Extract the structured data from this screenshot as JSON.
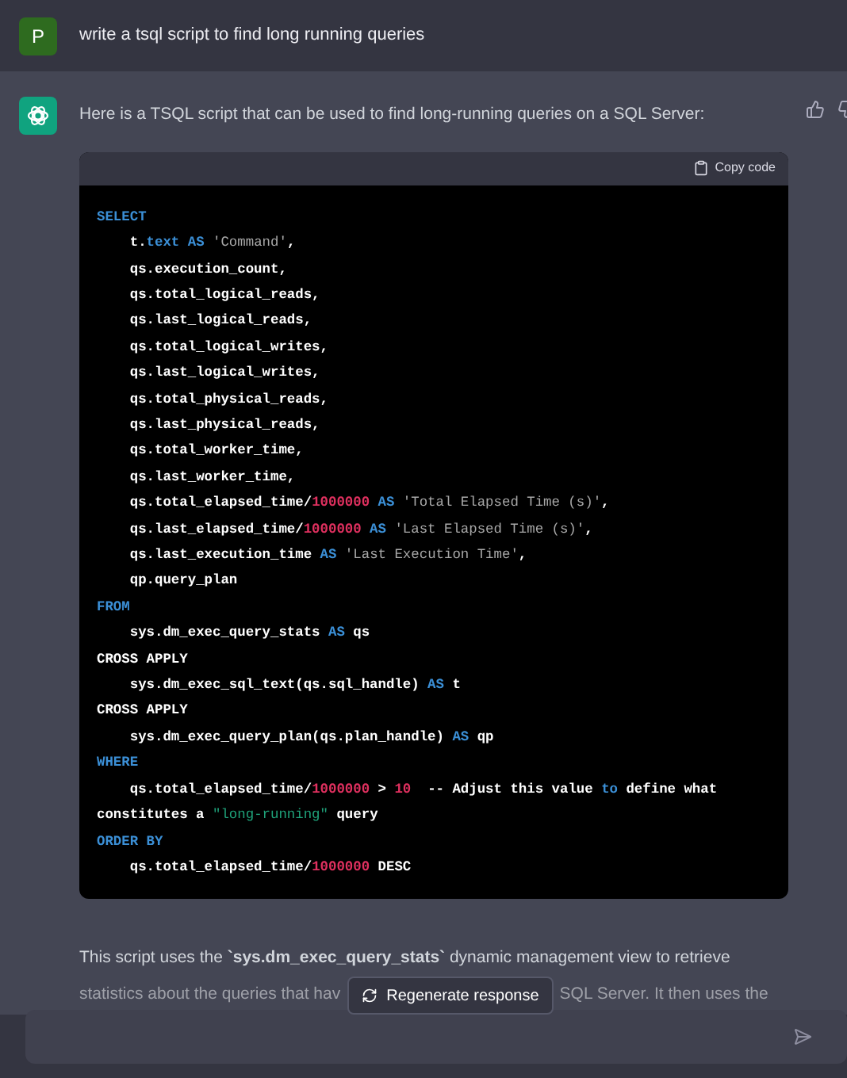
{
  "user_message": {
    "avatar": "P",
    "text": "write a tsql script to find long running queries"
  },
  "assistant_message": {
    "intro": "Here is a TSQL script that can be used to find long-running queries on a SQL Server:",
    "code_block": {
      "copy_label": "Copy code",
      "lines": [
        [
          {
            "text": "SELECT",
            "kind": "keyword"
          }
        ],
        [
          {
            "text": "    t.",
            "kind": "plain"
          },
          {
            "text": "text AS",
            "kind": "keyword"
          },
          {
            "text": " 'Command'",
            "kind": "string"
          },
          {
            "text": ",",
            "kind": "plain"
          }
        ],
        [
          {
            "text": "    qs.execution_count,",
            "kind": "plain"
          }
        ],
        [
          {
            "text": "    qs.total_logical_reads,",
            "kind": "plain"
          }
        ],
        [
          {
            "text": "    qs.last_logical_reads,",
            "kind": "plain"
          }
        ],
        [
          {
            "text": "    qs.total_logical_writes,",
            "kind": "plain"
          }
        ],
        [
          {
            "text": "    qs.last_logical_writes,",
            "kind": "plain"
          }
        ],
        [
          {
            "text": "    qs.total_physical_reads,",
            "kind": "plain"
          }
        ],
        [
          {
            "text": "    qs.last_physical_reads,",
            "kind": "plain"
          }
        ],
        [
          {
            "text": "    qs.total_worker_time,",
            "kind": "plain"
          }
        ],
        [
          {
            "text": "    qs.last_worker_time,",
            "kind": "plain"
          }
        ],
        [
          {
            "text": "    qs.total_elapsed_time/",
            "kind": "plain"
          },
          {
            "text": "1000000",
            "kind": "number"
          },
          {
            "text": " AS",
            "kind": "keyword"
          },
          {
            "text": " 'Total Elapsed Time (s)'",
            "kind": "string"
          },
          {
            "text": ",",
            "kind": "plain"
          }
        ],
        [
          {
            "text": "    qs.last_elapsed_time/",
            "kind": "plain"
          },
          {
            "text": "1000000",
            "kind": "number"
          },
          {
            "text": " AS",
            "kind": "keyword"
          },
          {
            "text": " 'Last Elapsed Time (s)'",
            "kind": "string"
          },
          {
            "text": ",",
            "kind": "plain"
          }
        ],
        [
          {
            "text": "    qs.last_execution_time ",
            "kind": "plain"
          },
          {
            "text": "AS",
            "kind": "keyword"
          },
          {
            "text": " 'Last Execution Time'",
            "kind": "string"
          },
          {
            "text": ",",
            "kind": "plain"
          }
        ],
        [
          {
            "text": "    qp.query_plan",
            "kind": "plain"
          }
        ],
        [
          {
            "text": "FROM",
            "kind": "keyword"
          }
        ],
        [
          {
            "text": "    sys.dm_exec_query_stats ",
            "kind": "plain"
          },
          {
            "text": "AS",
            "kind": "keyword"
          },
          {
            "text": " qs",
            "kind": "plain"
          }
        ],
        [
          {
            "text": "CROSS APPLY",
            "kind": "plain"
          }
        ],
        [
          {
            "text": "    sys.dm_exec_sql_text(qs.sql_handle) ",
            "kind": "plain"
          },
          {
            "text": "AS",
            "kind": "keyword"
          },
          {
            "text": " t",
            "kind": "plain"
          }
        ],
        [
          {
            "text": "CROSS APPLY",
            "kind": "plain"
          }
        ],
        [
          {
            "text": "    sys.dm_exec_query_plan(qs.plan_handle) ",
            "kind": "plain"
          },
          {
            "text": "AS",
            "kind": "keyword"
          },
          {
            "text": " qp",
            "kind": "plain"
          }
        ],
        [
          {
            "text": "WHERE",
            "kind": "keyword"
          }
        ],
        [
          {
            "text": "    qs.total_elapsed_time/",
            "kind": "plain"
          },
          {
            "text": "1000000",
            "kind": "number"
          },
          {
            "text": " > ",
            "kind": "plain"
          },
          {
            "text": "10",
            "kind": "number"
          },
          {
            "text": "  -- Adjust this value ",
            "kind": "plain"
          },
          {
            "text": "to",
            "kind": "keyword"
          },
          {
            "text": " define what constitutes a ",
            "kind": "plain"
          },
          {
            "text": "\"long-running\"",
            "kind": "quoted"
          },
          {
            "text": " query",
            "kind": "plain"
          }
        ],
        [
          {
            "text": "ORDER BY",
            "kind": "keyword"
          }
        ],
        [
          {
            "text": "    qs.total_elapsed_time/",
            "kind": "plain"
          },
          {
            "text": "1000000",
            "kind": "number"
          },
          {
            "text": " DESC",
            "kind": "plain"
          }
        ]
      ]
    },
    "explanation_line": "This script uses the **`sys.dm_exec_query_stats`** dynamic management view to retrieve",
    "explanation_fragments": [
      "statistics about the queries that hav",
      "SQL Server. It then uses the"
    ]
  },
  "regenerate_button": "Regenerate response"
}
